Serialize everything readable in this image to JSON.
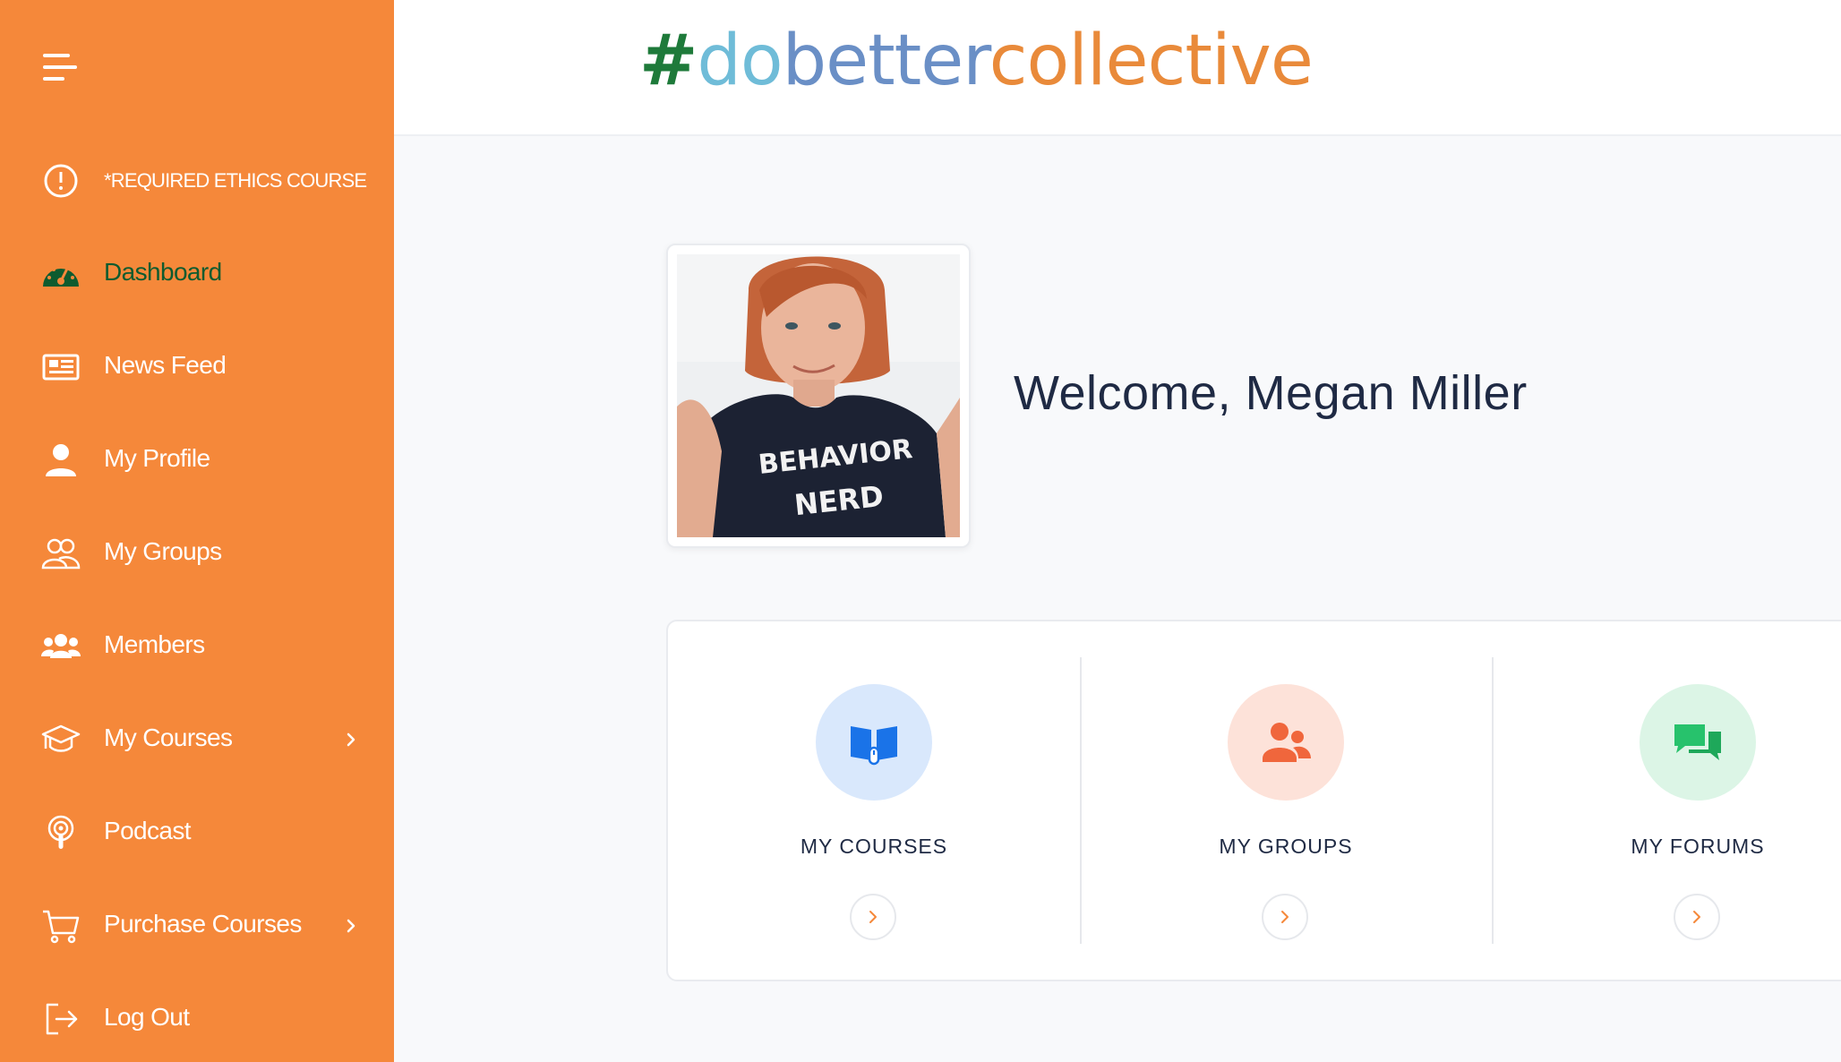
{
  "logo": {
    "hash": "#",
    "do": "do",
    "better": "better",
    "collective": "collective"
  },
  "sidebar": {
    "items": [
      {
        "label": "*REQUIRED ETHICS COURSE",
        "icon": "alert-circle-icon"
      },
      {
        "label": "Dashboard",
        "icon": "dashboard-icon",
        "active": true
      },
      {
        "label": "News Feed",
        "icon": "newspaper-icon"
      },
      {
        "label": "My Profile",
        "icon": "user-icon"
      },
      {
        "label": "My Groups",
        "icon": "groups-icon"
      },
      {
        "label": "Members",
        "icon": "members-icon"
      },
      {
        "label": "My Courses",
        "icon": "graduation-cap-icon",
        "has_submenu": true
      },
      {
        "label": "Podcast",
        "icon": "podcast-icon"
      },
      {
        "label": "Purchase Courses",
        "icon": "cart-icon",
        "has_submenu": true
      },
      {
        "label": "Log Out",
        "icon": "logout-icon"
      }
    ]
  },
  "main": {
    "welcome": "Welcome, Megan Miller",
    "photo_shirt_text": "BEHAVIOR NERD",
    "tiles": [
      {
        "label": "MY COURSES",
        "icon": "book-icon",
        "color": "#1a73e8",
        "bg": "#d9e8fc"
      },
      {
        "label": "MY GROUPS",
        "icon": "people-icon",
        "color": "#f0663c",
        "bg": "#fde2d9"
      },
      {
        "label": "MY FORUMS",
        "icon": "chat-icon",
        "color": "#27c26c",
        "bg": "#dcf5e6"
      }
    ]
  },
  "colors": {
    "sidebar_bg": "#f5883a",
    "active_text": "#0e5b2f",
    "accent": "#f5883a"
  }
}
